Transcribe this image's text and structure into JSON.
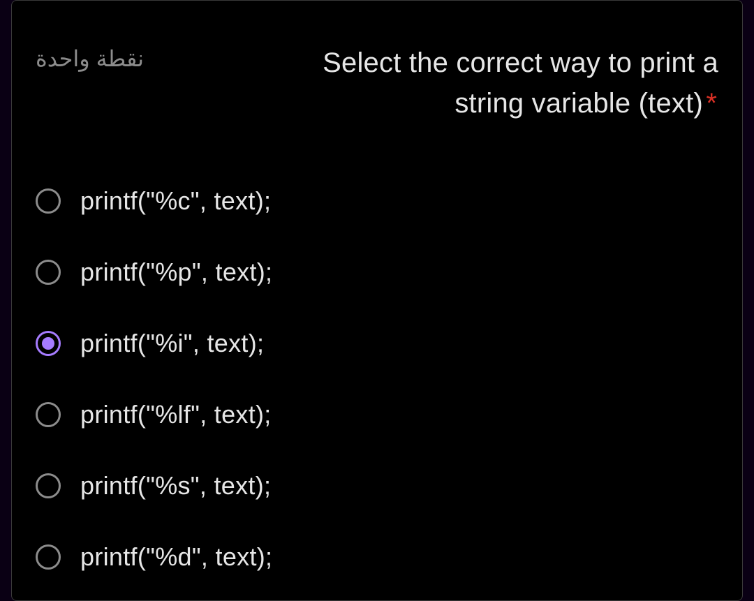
{
  "question": {
    "points": "نقطة واحدة",
    "text_line1": "Select the correct way to print a",
    "text_line2": "string variable (text)",
    "required_marker": "*"
  },
  "options": [
    {
      "label": "printf(\"%c\", text);",
      "selected": false
    },
    {
      "label": "printf(\"%p\", text);",
      "selected": false
    },
    {
      "label": "printf(\"%i\", text);",
      "selected": true
    },
    {
      "label": "printf(\"%lf\", text);",
      "selected": false
    },
    {
      "label": "printf(\"%s\", text);",
      "selected": false
    },
    {
      "label": "printf(\"%d\", text);",
      "selected": false
    }
  ]
}
